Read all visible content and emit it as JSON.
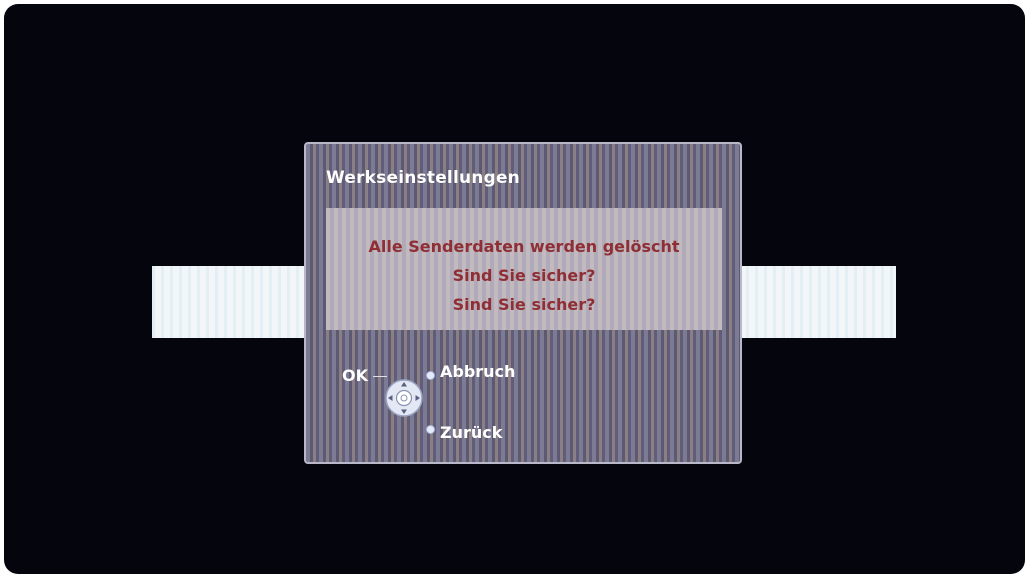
{
  "dialog": {
    "title": "Werkseinstellungen",
    "message_lines": [
      "Alle Senderdaten werden gelöscht",
      "Sind Sie sicher?",
      "Sind Sie sicher?"
    ]
  },
  "controls": {
    "ok_label": "OK",
    "cancel_label": "Abbruch",
    "back_label": "Zurück"
  },
  "colors": {
    "message_text": "#8f2e34",
    "screen_background": "#04050d",
    "label_text": "#ffffff"
  },
  "icons": {
    "navigation": "remote-dpad-icon",
    "option_bullet": "dot-icon"
  }
}
